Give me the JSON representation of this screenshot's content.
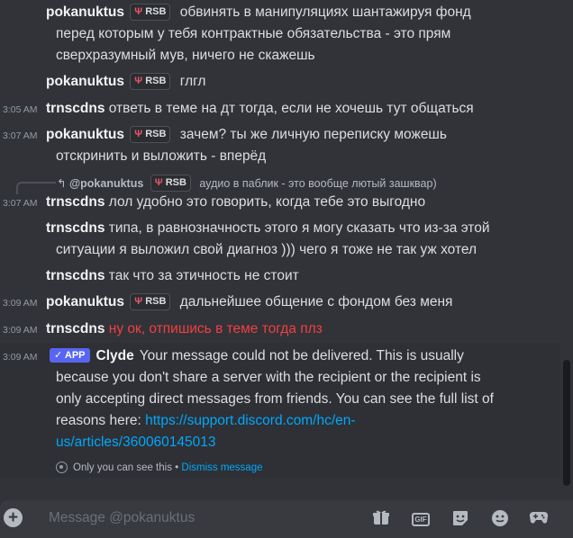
{
  "badge": {
    "label": "RSB"
  },
  "messages": [
    {
      "timestamp": "",
      "author": "pokanuktus",
      "text_l1": "обвинять в манипуляциях шантажируя фонд",
      "text_l2": "перед которым у тебя контрактные обязательства - это прям",
      "text_l3": "сверхразумный мув, ничего не скажешь"
    },
    {
      "timestamp": "",
      "author": "pokanuktus",
      "text_l1": "глгл"
    },
    {
      "timestamp": "3:05 AM",
      "author": "trnscdns",
      "text_l1": "ответь в теме на дт тогда, если не хочешь тут общаться"
    },
    {
      "timestamp": "3:07 AM",
      "author": "pokanuktus",
      "text_l1": "зачем? ты же личную переписку можешь",
      "text_l2": "отскринить и выложить - вперёд"
    },
    {
      "timestamp": "3:07 AM",
      "author": "trnscdns",
      "text_l1": "лол удобно это говорить, когда тебе это выгодно"
    },
    {
      "timestamp": "",
      "author": "trnscdns",
      "text_l1": "типа, в равнозначность этого я могу сказать что из-за этой",
      "text_l2": "ситуации я  выложил свой диагноз ))) чего я тоже не так уж хотел"
    },
    {
      "timestamp": "",
      "author": "trnscdns",
      "text_l1": "так что за этичность не стоит"
    },
    {
      "timestamp": "3:09 AM",
      "author": "pokanuktus",
      "text_l1": "дальнейшее общение с фондом без меня"
    },
    {
      "timestamp": "3:09 AM",
      "author": "trnscdns",
      "text_l1": "ну ок, отпишись в теме тогда плз"
    }
  ],
  "reply_preview": {
    "author": "@pokanuktus",
    "text": "аудио в паблик - это вообще лютый зашквар)"
  },
  "clyde": {
    "timestamp": "3:09 AM",
    "tag": "APP",
    "author": "Clyde",
    "text_l1": "Your message could not be delivered. This is usually",
    "text_l2": "because you don't share a server with the recipient or the recipient is",
    "text_l3": "only accepting direct messages from friends. You can see the full list of",
    "text_l4_prefix": "reasons here: ",
    "link_l1": "https://support.discord.com/hc/en-",
    "link_l2": "us/articles/360060145013",
    "ephemeral_note": "Only you can see this",
    "separator": "•",
    "dismiss": "Dismiss message"
  },
  "composer": {
    "placeholder": "Message @pokanuktus",
    "add_glyph": "+",
    "gif_label": "GIF"
  },
  "icons": [
    "add-icon",
    "gift-icon",
    "gif-icon",
    "sticker-icon",
    "emoji-icon",
    "game-icon"
  ],
  "colors": {
    "bg": "#313338",
    "red_text": "#f23f42",
    "link": "#00a8fc",
    "app_tag": "#5865f2"
  }
}
